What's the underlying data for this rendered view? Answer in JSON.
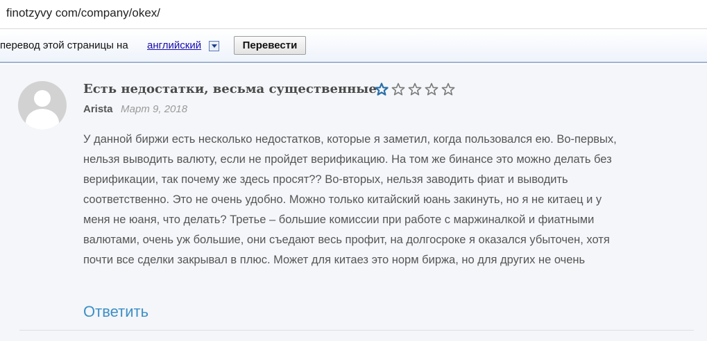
{
  "address_bar": {
    "url": "finotzyvy com/company/okex/"
  },
  "translate_bar": {
    "prefix": "перевод этой страницы на",
    "language": "английский",
    "translate_button": "Перевести"
  },
  "review": {
    "title": "Есть недостатки, весьма существенные",
    "rating": 1,
    "rating_max": 5,
    "star_filled_color": "#2a6fa8",
    "star_empty_color": "#7a7a7a",
    "author": "Arista",
    "date": "Март 9, 2018",
    "body_lines": [
      "У данной биржи есть несколько недостатков, которые я заметил, когда пользовался ею. Во-первых,",
      "нельзя выводить валюту, если не пройдет верификацию. На том же бинансе это можно делать без",
      "верификации, так почему же здесь просят?? Во-вторых, нельзя заводить фиат и выводить",
      "соответственно. Это не очень удобно. Можно только китайский юань закинуть, но я не китаец и у",
      "меня не юаня, что делать? Третье – большие комиссии при работе с маржиналкой и фиатными",
      "валютами, очень уж большие, они съедают весь профит, на долгосроке я оказался убыточен, хотя",
      "почти все сделки закрывал в плюс. Может для китаез это норм биржа, но для других не очень"
    ],
    "reply_label": "Ответить",
    "reply_color": "#3d8fc7"
  }
}
